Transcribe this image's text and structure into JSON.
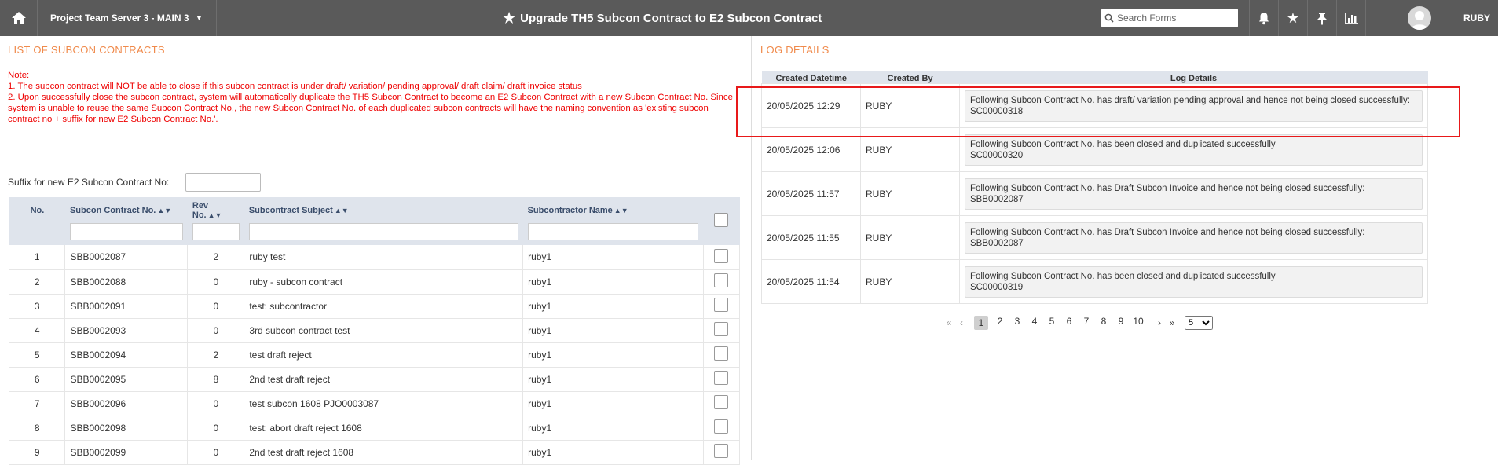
{
  "topbar": {
    "project": "Project Team Server 3 - MAIN 3",
    "title": "Upgrade TH5 Subcon Contract to E2 Subcon Contract",
    "search_placeholder": "Search Forms",
    "user": "RUBY"
  },
  "left": {
    "section_title": "LIST OF SUBCON CONTRACTS",
    "note_label": "Note:",
    "note1": "1. The subcon contract will NOT be able to close if this subcon contract is under draft/ variation/ pending approval/ draft claim/ draft invoice status",
    "note2": "2. Upon successfully close the subcon contract, system will automatically duplicate the TH5 Subcon Contract to become an E2 Subcon Contract with a new Subcon Contract No. Since system is unable to reuse the same Subcon Contract No., the new Subcon Contract No. of each duplicated subcon contracts will have the naming convention as 'existing subcon contract no + suffix for new E2 Subcon Contract No.'.",
    "suffix_label": "Suffix for new E2 Subcon Contract No:",
    "columns": {
      "no": "No.",
      "contract_no": "Subcon Contract No.",
      "rev_no": "Rev No.",
      "subject": "Subcontract Subject",
      "subcontractor": "Subcontractor Name"
    },
    "rows": [
      {
        "no": "1",
        "contract_no": "SBB0002087",
        "rev": "2",
        "subject": "ruby test",
        "subcontractor": "ruby1"
      },
      {
        "no": "2",
        "contract_no": "SBB0002088",
        "rev": "0",
        "subject": "ruby - subcon contract",
        "subcontractor": "ruby1"
      },
      {
        "no": "3",
        "contract_no": "SBB0002091",
        "rev": "0",
        "subject": "test: subcontractor",
        "subcontractor": "ruby1"
      },
      {
        "no": "4",
        "contract_no": "SBB0002093",
        "rev": "0",
        "subject": "3rd subcon contract test",
        "subcontractor": "ruby1"
      },
      {
        "no": "5",
        "contract_no": "SBB0002094",
        "rev": "2",
        "subject": "test draft reject",
        "subcontractor": "ruby1"
      },
      {
        "no": "6",
        "contract_no": "SBB0002095",
        "rev": "8",
        "subject": "2nd test draft reject",
        "subcontractor": "ruby1"
      },
      {
        "no": "7",
        "contract_no": "SBB0002096",
        "rev": "0",
        "subject": "test subcon 1608 PJO0003087",
        "subcontractor": "ruby1"
      },
      {
        "no": "8",
        "contract_no": "SBB0002098",
        "rev": "0",
        "subject": "test: abort draft reject 1608",
        "subcontractor": "ruby1"
      },
      {
        "no": "9",
        "contract_no": "SBB0002099",
        "rev": "0",
        "subject": "2nd test draft reject 1608",
        "subcontractor": "ruby1"
      }
    ]
  },
  "right": {
    "section_title": "LOG DETAILS",
    "columns": {
      "datetime": "Created Datetime",
      "by": "Created By",
      "details": "Log Details"
    },
    "logs": [
      {
        "datetime": "20/05/2025 12:29",
        "by": "RUBY",
        "line1": "Following Subcon Contract No. has draft/ variation pending approval and hence not being closed successfully:",
        "line2": "SC00000318"
      },
      {
        "datetime": "20/05/2025 12:06",
        "by": "RUBY",
        "line1": "Following Subcon Contract No. has been closed and duplicated successfully",
        "line2": "SC00000320"
      },
      {
        "datetime": "20/05/2025 11:57",
        "by": "RUBY",
        "line1": "Following Subcon Contract No. has Draft Subcon Invoice and hence not being closed successfully:",
        "line2": "SBB0002087"
      },
      {
        "datetime": "20/05/2025 11:55",
        "by": "RUBY",
        "line1": "Following Subcon Contract No. has Draft Subcon Invoice and hence not being closed successfully:",
        "line2": "SBB0002087"
      },
      {
        "datetime": "20/05/2025 11:54",
        "by": "RUBY",
        "line1": "Following Subcon Contract No. has been closed and duplicated successfully",
        "line2": "SC00000319"
      }
    ],
    "pager": {
      "pages": [
        "1",
        "2",
        "3",
        "4",
        "5",
        "6",
        "7",
        "8",
        "9",
        "10"
      ],
      "current": "1",
      "page_size": "5"
    }
  }
}
